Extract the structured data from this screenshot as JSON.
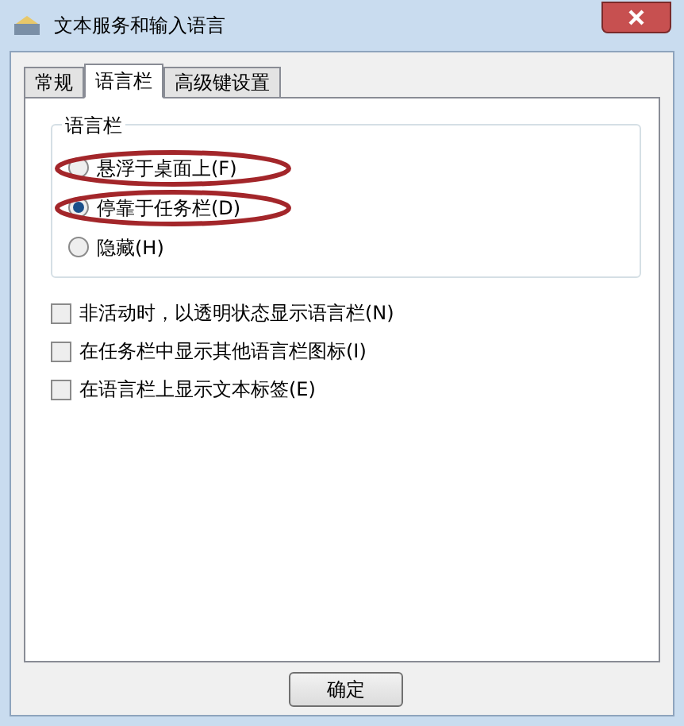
{
  "window": {
    "title": "文本服务和输入语言"
  },
  "tabs": [
    {
      "label": "常规",
      "selected": false
    },
    {
      "label": "语言栏",
      "selected": true
    },
    {
      "label": "高级键设置",
      "selected": false
    }
  ],
  "group": {
    "title": "语言栏",
    "options": [
      {
        "label": "悬浮于桌面上(F)",
        "selected": false,
        "circled": true
      },
      {
        "label": "停靠于任务栏(D)",
        "selected": true,
        "circled": true
      },
      {
        "label": "隐藏(H)",
        "selected": false,
        "circled": false
      }
    ]
  },
  "checkboxes": [
    {
      "label": "非活动时，以透明状态显示语言栏(N)",
      "checked": false
    },
    {
      "label": "在任务栏中显示其他语言栏图标(I)",
      "checked": false
    },
    {
      "label": "在语言栏上显示文本标签(E)",
      "checked": false
    }
  ],
  "buttons": [
    "确定"
  ]
}
